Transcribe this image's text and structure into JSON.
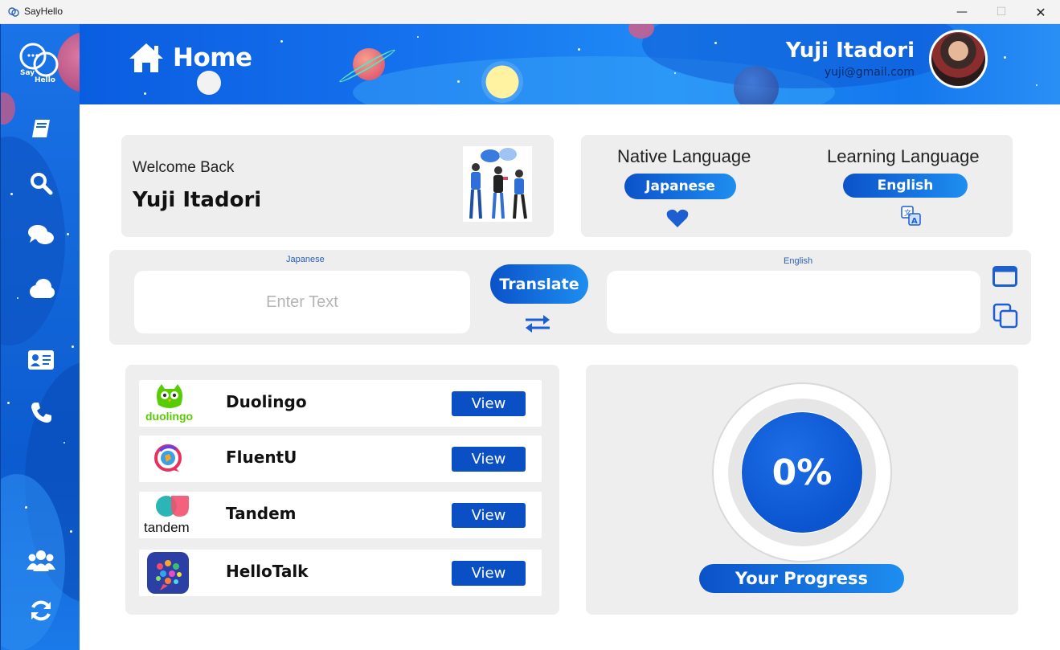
{
  "window": {
    "title": "SayHello",
    "minimize_glyph": "—",
    "maximize_glyph": "☐",
    "close_glyph": "✕"
  },
  "logo": {
    "text_top": "Say",
    "text_bottom": "Hello"
  },
  "header": {
    "title": "Home",
    "user_name": "Yuji Itadori",
    "user_email": "yuji@gmail.com"
  },
  "sidebar": {
    "items": [
      {
        "icon": "book-icon"
      },
      {
        "icon": "search-icon"
      },
      {
        "icon": "chat-icon"
      },
      {
        "icon": "cloud-icon"
      },
      {
        "icon": "contact-card-icon"
      },
      {
        "icon": "phone-icon"
      },
      {
        "icon": "users-icon"
      },
      {
        "icon": "refresh-icon"
      }
    ]
  },
  "welcome": {
    "greeting": "Welcome Back",
    "name": "Yuji Itadori"
  },
  "languages": {
    "native_label": "Native Language",
    "native_value": "Japanese",
    "learning_label": "Learning Language",
    "learning_value": "English"
  },
  "translator": {
    "source_label": "Japanese",
    "target_label": "English",
    "source_placeholder": "Enter Text",
    "target_value": "",
    "translate_label": "Translate"
  },
  "apps": [
    {
      "name": "Duolingo",
      "logo_text": "duolingo",
      "view_label": "View"
    },
    {
      "name": "FluentU",
      "logo_text": "",
      "view_label": "View"
    },
    {
      "name": "Tandem",
      "logo_text": "tandem",
      "view_label": "View"
    },
    {
      "name": "HelloTalk",
      "logo_text": "",
      "view_label": "View"
    }
  ],
  "progress": {
    "value_text": "0%",
    "value": 0,
    "label": "Your Progress"
  },
  "colors": {
    "accent": "#0b55d0",
    "panel": "#eeeeee",
    "header_gradient_start": "#0a5de0",
    "header_gradient_end": "#2a8ff5"
  }
}
